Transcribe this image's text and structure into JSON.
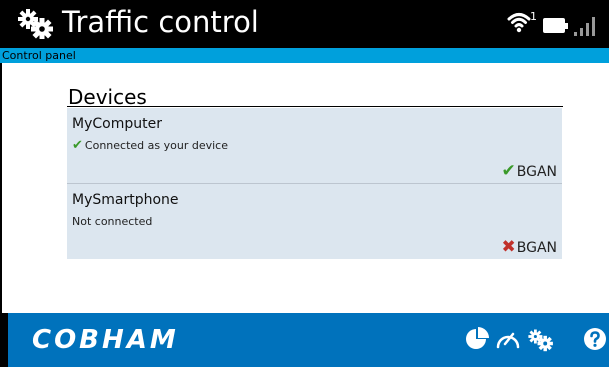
{
  "header": {
    "title": "Traffic control",
    "wifi_count": "1",
    "icons": [
      "gears-icon",
      "wifi-icon",
      "battery-icon",
      "signal-icon"
    ]
  },
  "breadcrumb": "Control panel",
  "devices_section": {
    "title": "Devices",
    "items": [
      {
        "name": "MyComputer",
        "status": "Connected as your device",
        "status_icon": "check-icon",
        "network": "BGAN",
        "network_icon": "check-icon"
      },
      {
        "name": "MySmartphone",
        "status": "Not connected",
        "network": "BGAN",
        "network_icon": "cross-icon"
      }
    ]
  },
  "footer": {
    "brand": "COBHAM",
    "icons": [
      "pie-chart-icon",
      "speedometer-icon",
      "settings-icon",
      "help-icon"
    ]
  },
  "colors": {
    "header_bg": "#000000",
    "breadcrumb_bg": "#00a0dc",
    "device_bg": "#dce6ef",
    "footer_bg": "#0072bc",
    "ok": "#3a9a2a",
    "error": "#c0312b"
  }
}
